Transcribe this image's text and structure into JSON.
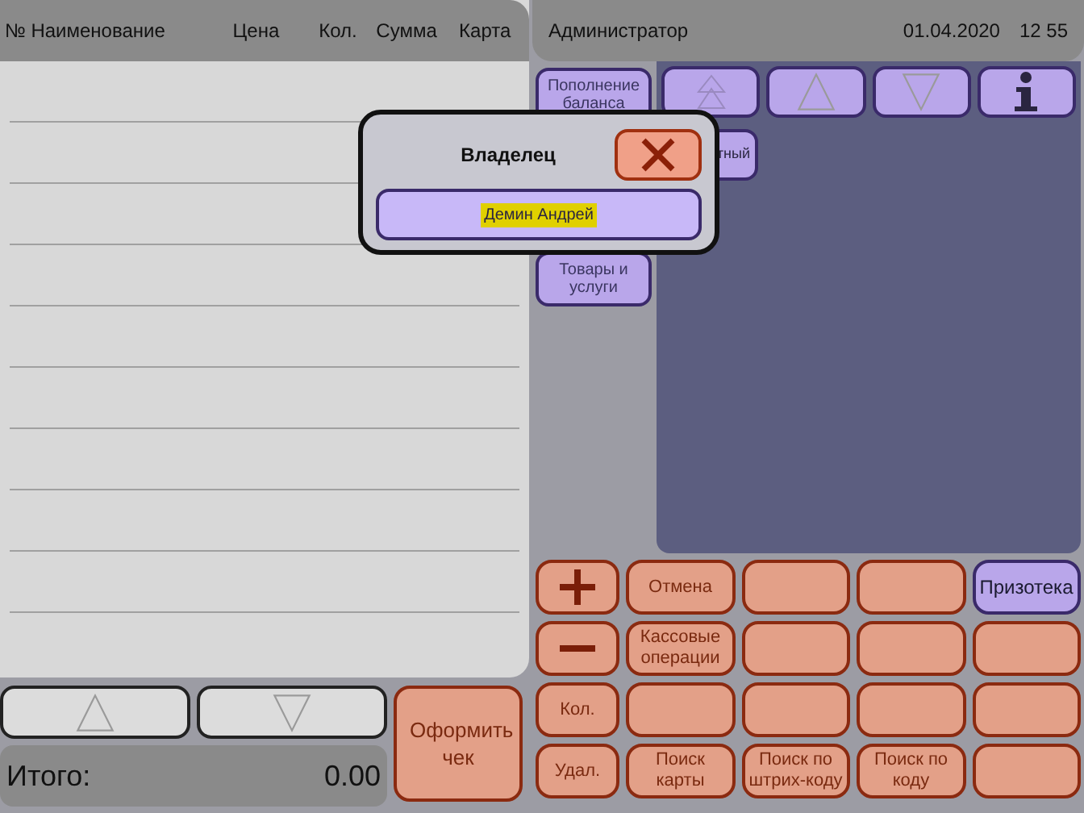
{
  "receipt": {
    "columns": [
      "№ Наименование",
      "Цена",
      "Кол.",
      "Сумма",
      "Карта"
    ],
    "scroll_buttons": [
      {
        "kind": "up"
      },
      {
        "kind": "down"
      }
    ],
    "total": {
      "label": "Итого:",
      "value": "0.00"
    },
    "checkout_button": "Оформить чек"
  },
  "header": {
    "user": "Администратор",
    "date": "01.04.2020",
    "time": "12 55"
  },
  "categories": [
    {
      "label": "Пополнение баланса",
      "kind": "normal"
    },
    {
      "label": "тный",
      "kind": "wide"
    },
    {
      "label": "Товары и услуги",
      "kind": "normal"
    }
  ],
  "nav_buttons": [
    {
      "kind": "top"
    },
    {
      "kind": "up"
    },
    {
      "kind": "down"
    },
    {
      "kind": "info"
    }
  ],
  "keypad": [
    {
      "kind": "plus"
    },
    {
      "kind": "text",
      "label": "Отмена"
    },
    {
      "kind": "blank"
    },
    {
      "kind": "blank"
    },
    {
      "kind": "accent",
      "label": "Призотека"
    },
    {
      "kind": "minus"
    },
    {
      "kind": "text",
      "label": "Кассовые операции"
    },
    {
      "kind": "blank"
    },
    {
      "kind": "blank"
    },
    {
      "kind": "blank"
    },
    {
      "kind": "text",
      "label": "Кол."
    },
    {
      "kind": "blank"
    },
    {
      "kind": "blank"
    },
    {
      "kind": "blank"
    },
    {
      "kind": "blank"
    },
    {
      "kind": "text",
      "label": "Удал."
    },
    {
      "kind": "text",
      "label": "Поиск карты"
    },
    {
      "kind": "text",
      "label": "Поиск по штрих-коду"
    },
    {
      "kind": "text",
      "label": "Поиск по коду"
    },
    {
      "kind": "blank"
    }
  ],
  "dialog": {
    "title": "Владелец",
    "items": [
      {
        "label": "Демин Андрей",
        "selected": true
      }
    ]
  }
}
